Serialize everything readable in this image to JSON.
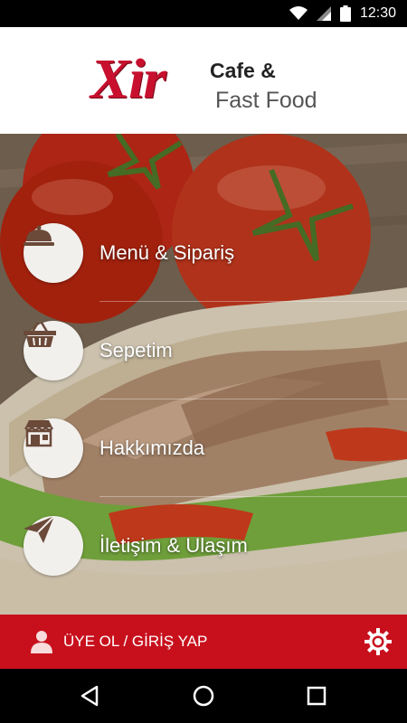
{
  "status_bar": {
    "time": "12:30",
    "icons": [
      "wifi-icon",
      "signal-icon",
      "battery-icon"
    ]
  },
  "header": {
    "logo_main": "Xir",
    "logo_line1": "Cafe &",
    "logo_line2": "Fast Food"
  },
  "menu": {
    "items": [
      {
        "label": "Menü & Sipariş",
        "icon": "cloche-icon"
      },
      {
        "label": "Sepetim",
        "icon": "basket-icon"
      },
      {
        "label": "Hakkımızda",
        "icon": "storefront-icon"
      },
      {
        "label": "İletişim & Ulaşım",
        "icon": "paper-plane-icon"
      }
    ]
  },
  "bottom_bar": {
    "login_label": "ÜYE OL / GİRİŞ YAP",
    "login_icon": "user-icon",
    "settings_icon": "gear-icon"
  },
  "nav_bar": {
    "buttons": [
      "back-icon",
      "home-icon",
      "recents-icon"
    ]
  },
  "colors": {
    "brand_red": "#c8101d",
    "icon_brown": "#6b4a3a"
  }
}
